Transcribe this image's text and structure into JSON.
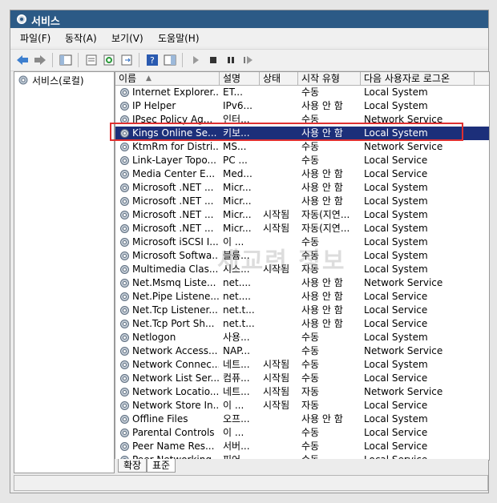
{
  "window": {
    "title": "서비스"
  },
  "menu": [
    "파일(F)",
    "동작(A)",
    "보기(V)",
    "도움말(H)"
  ],
  "toolbar": {
    "buttons": [
      "back-icon",
      "forward-icon",
      "show-hide-console-tree-icon",
      "properties-icon",
      "refresh-icon",
      "export-list-icon",
      "help-icon",
      "action-pane-icon",
      "start-service-icon",
      "stop-service-icon",
      "pause-service-icon",
      "restart-service-icon"
    ]
  },
  "tree": {
    "root_label": "서비스(로컬)"
  },
  "columns": {
    "name": "이름",
    "desc": "설명",
    "status": "상태",
    "startup": "시작 유형",
    "logon": "다음 사용자로 로그온"
  },
  "services": [
    {
      "name": "Internet Explorer...",
      "desc": "ET...",
      "status": "",
      "startup": "수동",
      "logon": "Local System"
    },
    {
      "name": "IP Helper",
      "desc": "IPv6...",
      "status": "",
      "startup": "사용 안 함",
      "logon": "Local System"
    },
    {
      "name": "IPsec Policy Ag...",
      "desc": "인터...",
      "status": "",
      "startup": "수동",
      "logon": "Network Service"
    },
    {
      "name": "Kings Online Se...",
      "desc": "키보...",
      "status": "",
      "startup": "사용 안 함",
      "logon": "Local System",
      "selected": true
    },
    {
      "name": "KtmRm for Distri...",
      "desc": "MS...",
      "status": "",
      "startup": "수동",
      "logon": "Network Service"
    },
    {
      "name": "Link-Layer Topo...",
      "desc": "PC ...",
      "status": "",
      "startup": "수동",
      "logon": "Local Service"
    },
    {
      "name": "Media Center E...",
      "desc": "Med...",
      "status": "",
      "startup": "사용 안 함",
      "logon": "Local Service"
    },
    {
      "name": "Microsoft .NET ...",
      "desc": "Micr...",
      "status": "",
      "startup": "사용 안 함",
      "logon": "Local System"
    },
    {
      "name": "Microsoft .NET ...",
      "desc": "Micr...",
      "status": "",
      "startup": "사용 안 함",
      "logon": "Local System"
    },
    {
      "name": "Microsoft .NET ...",
      "desc": "Micr...",
      "status": "시작됨",
      "startup": "자동(지연...",
      "logon": "Local System"
    },
    {
      "name": "Microsoft .NET ...",
      "desc": "Micr...",
      "status": "시작됨",
      "startup": "자동(지연...",
      "logon": "Local System"
    },
    {
      "name": "Microsoft iSCSI I...",
      "desc": "이 ...",
      "status": "",
      "startup": "수동",
      "logon": "Local System"
    },
    {
      "name": "Microsoft Softwa...",
      "desc": "블륨...",
      "status": "",
      "startup": "수동",
      "logon": "Local System"
    },
    {
      "name": "Multimedia Clas...",
      "desc": "시스...",
      "status": "시작됨",
      "startup": "자동",
      "logon": "Local System"
    },
    {
      "name": "Net.Msmq Liste...",
      "desc": "net....",
      "status": "",
      "startup": "사용 안 함",
      "logon": "Network Service"
    },
    {
      "name": "Net.Pipe Listene...",
      "desc": "net....",
      "status": "",
      "startup": "사용 안 함",
      "logon": "Local Service"
    },
    {
      "name": "Net.Tcp Listener...",
      "desc": "net.t...",
      "status": "",
      "startup": "사용 안 함",
      "logon": "Local Service"
    },
    {
      "name": "Net.Tcp Port Sh...",
      "desc": "net.t...",
      "status": "",
      "startup": "사용 안 함",
      "logon": "Local Service"
    },
    {
      "name": "Netlogon",
      "desc": "사용...",
      "status": "",
      "startup": "수동",
      "logon": "Local System"
    },
    {
      "name": "Network Access...",
      "desc": "NAP...",
      "status": "",
      "startup": "수동",
      "logon": "Network Service"
    },
    {
      "name": "Network Connec...",
      "desc": "네트...",
      "status": "시작됨",
      "startup": "수동",
      "logon": "Local System"
    },
    {
      "name": "Network List Ser...",
      "desc": "컴퓨...",
      "status": "시작됨",
      "startup": "수동",
      "logon": "Local Service"
    },
    {
      "name": "Network Locatio...",
      "desc": "네트...",
      "status": "시작됨",
      "startup": "자동",
      "logon": "Network Service"
    },
    {
      "name": "Network Store In...",
      "desc": "이 ...",
      "status": "시작됨",
      "startup": "자동",
      "logon": "Local Service"
    },
    {
      "name": "Offline Files",
      "desc": "오프...",
      "status": "",
      "startup": "사용 안 함",
      "logon": "Local System"
    },
    {
      "name": "Parental Controls",
      "desc": "이 ...",
      "status": "",
      "startup": "수동",
      "logon": "Local Service"
    },
    {
      "name": "Peer Name Res...",
      "desc": "서버...",
      "status": "",
      "startup": "수동",
      "logon": "Local Service"
    },
    {
      "name": "Peer Networking...",
      "desc": "피어...",
      "status": "",
      "startup": "수동",
      "logon": "Local Service"
    }
  ],
  "tabs": [
    "확장",
    "표준"
  ],
  "watermark": "세교련 정보",
  "colors": {
    "selection": "#1c2f7a",
    "highlight_box": "#e03030",
    "titlebar": "#2c5a86"
  }
}
